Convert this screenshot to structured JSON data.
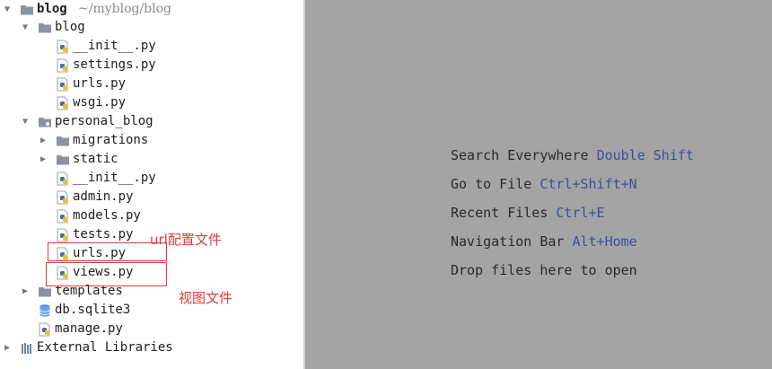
{
  "project": {
    "name": "blog",
    "path": "~/myblog/blog"
  },
  "tree": [
    {
      "label": "blog",
      "kind": "folder",
      "expanded": true
    },
    {
      "label": "__init__.py",
      "kind": "python"
    },
    {
      "label": "settings.py",
      "kind": "python"
    },
    {
      "label": "urls.py",
      "kind": "python"
    },
    {
      "label": "wsgi.py",
      "kind": "python"
    },
    {
      "label": "personal_blog",
      "kind": "folder",
      "expanded": true
    },
    {
      "label": "migrations",
      "kind": "folder",
      "expanded": false
    },
    {
      "label": "static",
      "kind": "folder",
      "expanded": false
    },
    {
      "label": "__init__.py",
      "kind": "python"
    },
    {
      "label": "admin.py",
      "kind": "python"
    },
    {
      "label": "models.py",
      "kind": "python"
    },
    {
      "label": "tests.py",
      "kind": "python"
    },
    {
      "label": "urls.py",
      "kind": "python"
    },
    {
      "label": "views.py",
      "kind": "python"
    },
    {
      "label": "templates",
      "kind": "folder",
      "expanded": false
    },
    {
      "label": "db.sqlite3",
      "kind": "database"
    },
    {
      "label": "manage.py",
      "kind": "python"
    },
    {
      "label": "External Libraries",
      "kind": "library",
      "expanded": false
    }
  ],
  "annotations": {
    "urls": "url配置文件",
    "views": "视图文件"
  },
  "hints": [
    {
      "label": "Search Everywhere",
      "shortcut": "Double Shift"
    },
    {
      "label": "Go to File",
      "shortcut": "Ctrl+Shift+N"
    },
    {
      "label": "Recent Files",
      "shortcut": "Ctrl+E"
    },
    {
      "label": "Navigation Bar",
      "shortcut": "Alt+Home"
    },
    {
      "label": "Drop files here to open",
      "shortcut": ""
    }
  ],
  "colors": {
    "editor_bg": "#a4a4a4",
    "shortcut": "#3d4f9e",
    "annotation": "#e23a3a"
  }
}
